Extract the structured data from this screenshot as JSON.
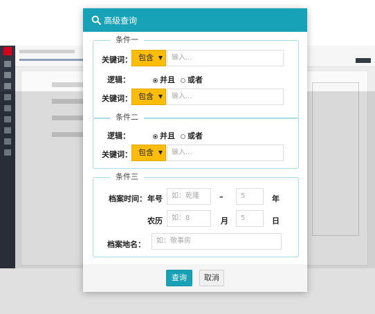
{
  "dialog": {
    "title": "高级查询",
    "icon": "search-icon"
  },
  "condition1": {
    "legend": "条件一",
    "keyword_label": "关键词：",
    "match_option": "包含",
    "input_placeholder": "输入...",
    "logic_label": "逻辑：",
    "logic_and": "并且",
    "logic_or": "或者",
    "logic_selected": "并且",
    "keyword2_label": "关键词：",
    "match_option2": "包含",
    "input2_placeholder": "输入..."
  },
  "condition2": {
    "legend": "条件二",
    "logic_label": "逻辑：",
    "logic_and": "并且",
    "logic_or": "或者",
    "logic_selected": "并且",
    "keyword_label": "关键词：",
    "match_option": "包含",
    "input_placeholder": "输入..."
  },
  "condition3": {
    "legend": "条件三",
    "archive_time_label": "档案时间：",
    "year_label": "年号",
    "year_placeholder": "如：乾隆",
    "dash": "–",
    "year_num_placeholder": "5",
    "year_unit": "年",
    "lunar_label": "农历",
    "month_placeholder": "如：8",
    "month_unit": "月",
    "day_placeholder": "5",
    "day_unit": "日",
    "place_label": "档案地名：",
    "place_placeholder": "如：敬事房"
  },
  "footer": {
    "search_button": "查询",
    "cancel_button": "取消"
  },
  "colors": {
    "accent": "#17a2b8",
    "dropdown": "#fbbd08",
    "group_border": "#a8dbe3"
  }
}
